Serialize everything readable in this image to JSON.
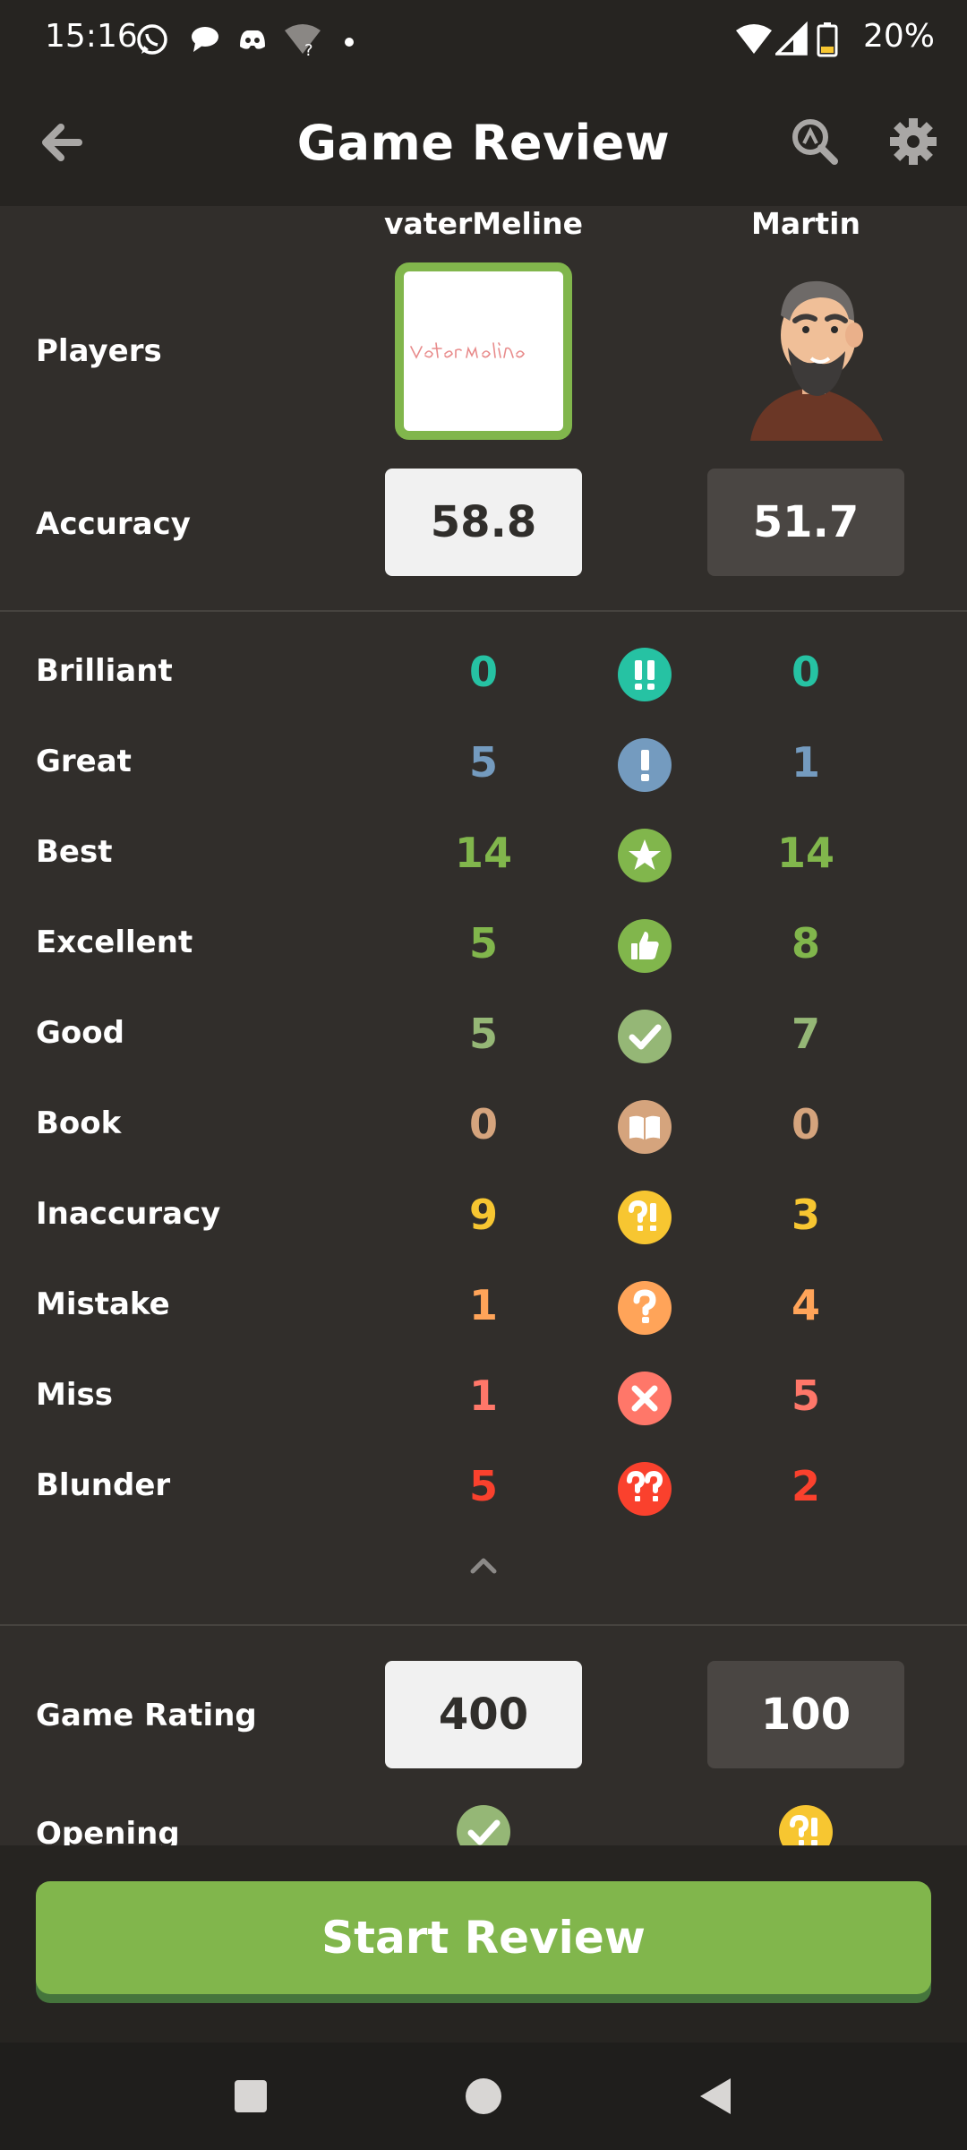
{
  "status_bar": {
    "time": "15:16",
    "battery": "20%"
  },
  "header": {
    "title": "Game Review"
  },
  "players": {
    "label": "Players",
    "white": {
      "name": "vaterMeline",
      "signature": "VaterMeline"
    },
    "black": {
      "name": "Martin"
    }
  },
  "accuracy": {
    "label": "Accuracy",
    "white": "58.8",
    "black": "51.7"
  },
  "moves": [
    {
      "label": "Brilliant",
      "white": "0",
      "black": "0",
      "color": "#26c2a3",
      "icon": "brilliant-icon"
    },
    {
      "label": "Great",
      "white": "5",
      "black": "1",
      "color": "#749bbf",
      "icon": "great-icon"
    },
    {
      "label": "Best",
      "white": "14",
      "black": "14",
      "color": "#81b64c",
      "icon": "best-icon"
    },
    {
      "label": "Excellent",
      "white": "5",
      "black": "8",
      "color": "#81b64c",
      "icon": "excellent-icon"
    },
    {
      "label": "Good",
      "white": "5",
      "black": "7",
      "color": "#95b776",
      "icon": "good-icon"
    },
    {
      "label": "Book",
      "white": "0",
      "black": "0",
      "color": "#d5a47d",
      "icon": "book-icon"
    },
    {
      "label": "Inaccuracy",
      "white": "9",
      "black": "3",
      "color": "#f7c631",
      "icon": "inaccuracy-icon"
    },
    {
      "label": "Mistake",
      "white": "1",
      "black": "4",
      "color": "#ffa459",
      "icon": "mistake-icon"
    },
    {
      "label": "Miss",
      "white": "1",
      "black": "5",
      "color": "#ff7769",
      "icon": "miss-icon"
    },
    {
      "label": "Blunder",
      "white": "5",
      "black": "2",
      "color": "#fa412d",
      "icon": "blunder-icon"
    }
  ],
  "game_rating": {
    "label": "Game Rating",
    "white": "400",
    "black": "100"
  },
  "opening": {
    "label": "Opening"
  },
  "start_button": {
    "label": "Start Review"
  }
}
